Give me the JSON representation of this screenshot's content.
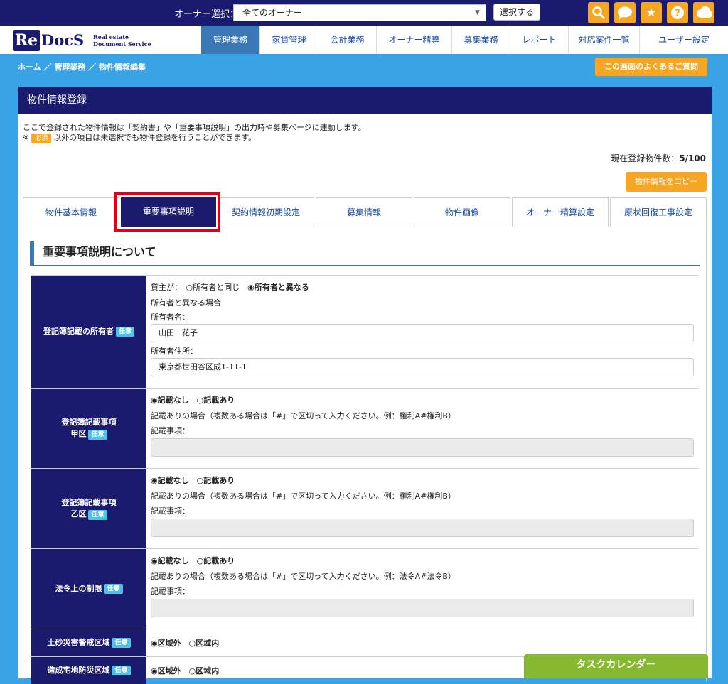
{
  "topbar": {
    "owner_label": "オーナー選択：",
    "owner_value": "全てのオーナー",
    "select_button": "選択する",
    "colors": {
      "bar": "#1a1a6e",
      "icon": "#f5a623"
    },
    "icons": [
      "search-icon",
      "chat-icon",
      "star-icon",
      "help-icon",
      "cloud-icon"
    ]
  },
  "logo": {
    "re": "Re",
    "docs": "DocS",
    "sub1": "Real estate",
    "sub2": "Document Service"
  },
  "nav": {
    "items": [
      "管理業務",
      "家賃管理",
      "会計業務",
      "オーナー精算",
      "募集業務",
      "レポート",
      "対応案件一覧",
      "ユーザー設定"
    ],
    "active": "管理業務"
  },
  "breadcrumb": "ホーム ／ 管理業務 ／ 物件情報編集",
  "faq_button": "この画面のよくあるご質問",
  "panel": {
    "title": "物件情報登録",
    "desc1": "ここで登録された物件情報は「契約書」や「重要事項説明」の出力時や募集ページに連動します。",
    "desc2_prefix": "※",
    "desc2_badge": "必須",
    "desc2_suffix": "以外の項目は未選択でも物件登録を行うことができます。",
    "count_label": "現在登録物件数：",
    "count_value": "5/100",
    "copy_button": "物件情報をコピー"
  },
  "tabs": [
    "物件基本情報",
    "重要事項説明",
    "契約情報初期設定",
    "募集情報",
    "物件画像",
    "オーナー精算設定",
    "原状回復工事設定"
  ],
  "section_title": "重要事項説明について",
  "form": {
    "badge": "任意",
    "owner": {
      "label": "登記簿記載の所有者",
      "lessor_label": "貸主が：",
      "opt_same": "○所有者と同じ",
      "opt_diff": "◉所有者と異なる",
      "note": "所有者と異なる場合",
      "name_label": "所有者名：",
      "name_value": "山田　花子",
      "addr_label": "所有者住所：",
      "addr_value": "東京都世田谷区成1-11-1"
    },
    "kouku": {
      "label1": "登記簿記載事項",
      "label2": "甲区",
      "opt_none": "◉記載なし",
      "opt_yes": "○記載あり",
      "note": "記載ありの場合（複数ある場合は「#」で区切って入力ください。例：権利A#権利B）",
      "field_label": "記載事項："
    },
    "otsuku": {
      "label1": "登記簿記載事項",
      "label2": "乙区",
      "opt_none": "◉記載なし",
      "opt_yes": "○記載あり",
      "note": "記載ありの場合（複数ある場合は「#」で区切って入力ください。例：権利A#権利B）",
      "field_label": "記載事項："
    },
    "legal": {
      "label": "法令上の制限",
      "opt_none": "◉記載なし",
      "opt_yes": "○記載あり",
      "note": "記載ありの場合（複数ある場合は「#」で区切って入力ください。例：法令A#法令B）",
      "field_label": "記載事項："
    },
    "sediment": {
      "label": "土砂災害警戒区域",
      "opt_out": "◉区域外",
      "opt_in": "○区域内"
    },
    "landslide": {
      "label": "造成宅地防災区域",
      "opt_out": "◉区域外",
      "opt_in": "○区域内"
    }
  },
  "task_calendar": "タスクカレンダー"
}
